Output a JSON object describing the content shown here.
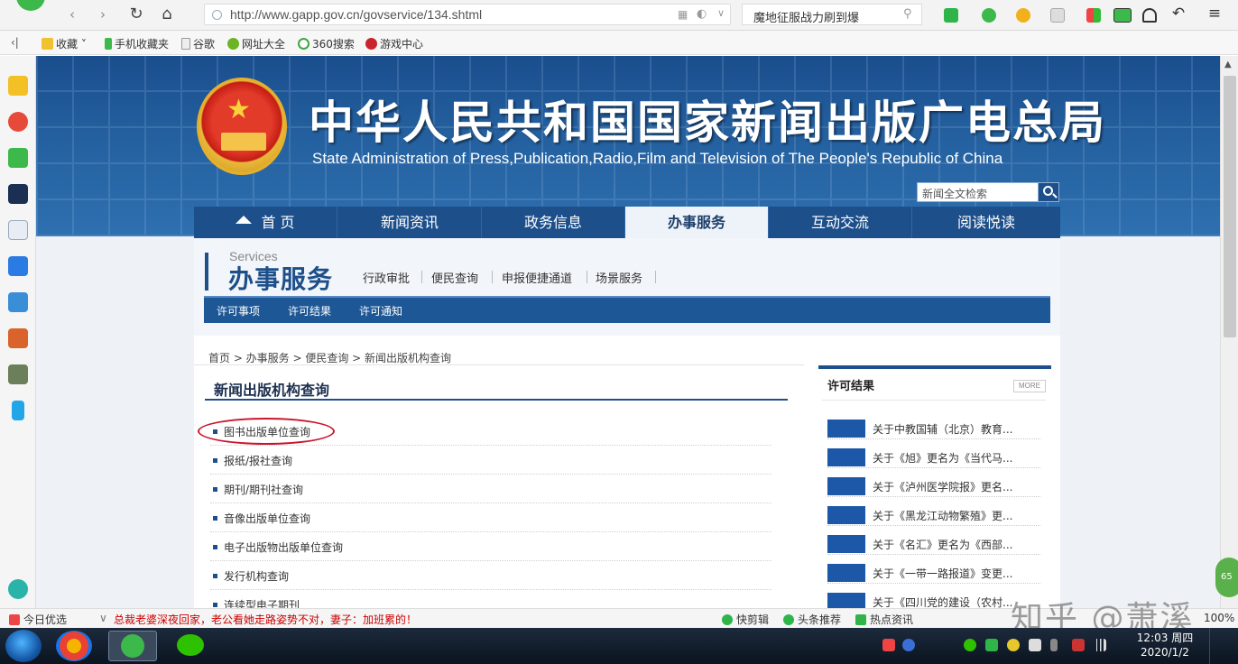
{
  "browser": {
    "url": "http://www.gapp.gov.cn/govservice/134.shtml",
    "search_text": "魔地征服战力刷到爆"
  },
  "bookmarks": [
    "收藏",
    "手机收藏夹",
    "谷歌",
    "网址大全",
    "360搜索",
    "游戏中心"
  ],
  "site": {
    "title": "中华人民共和国国家新闻出版广电总局",
    "subtitle": "State Administration of Press,Publication,Radio,Film and Television of The People's Republic of China",
    "search_placeholder": "新闻全文检索"
  },
  "nav": [
    "首 页",
    "新闻资讯",
    "政务信息",
    "办事服务",
    "互动交流",
    "阅读悦读"
  ],
  "services": {
    "en": "Services",
    "cn": "办事服务",
    "links": [
      "行政审批",
      "便民查询",
      "申报便捷通道",
      "场景服务"
    ],
    "subnav": [
      "许可事项",
      "许可结果",
      "许可通知"
    ]
  },
  "breadcrumb": "首页 > 办事服务 > 便民查询 > 新闻出版机构查询",
  "main": {
    "title": "新闻出版机构查询",
    "items": [
      "图书出版单位查询",
      "报纸/报社查询",
      "期刊/期刊社查询",
      "音像出版单位查询",
      "电子出版物出版单位查询",
      "发行机构查询",
      "连续型电子期刊"
    ]
  },
  "side": {
    "title": "许可结果",
    "more": "MORE",
    "items": [
      "关于中教国辅（北京）教育...",
      "关于《旭》更名为《当代马...",
      "关于《泸州医学院报》更名...",
      "关于《黑龙江动物繁殖》更...",
      "关于《名汇》更名为《西部...",
      "关于《一带一路报道》变更...",
      "关于《四川党的建设（农村..."
    ]
  },
  "status": {
    "left": "今日优选",
    "news": "总裁老婆深夜回家，老公看她走路姿势不对，妻子：加班累的！",
    "tools": [
      "快剪辑",
      "头条推荐",
      "热点资讯"
    ],
    "zoom": "100%"
  },
  "watermark": "知乎 @萧溪",
  "side_badge": "65",
  "clock": {
    "time": "12:03 周四",
    "date": "2020/1/2"
  }
}
